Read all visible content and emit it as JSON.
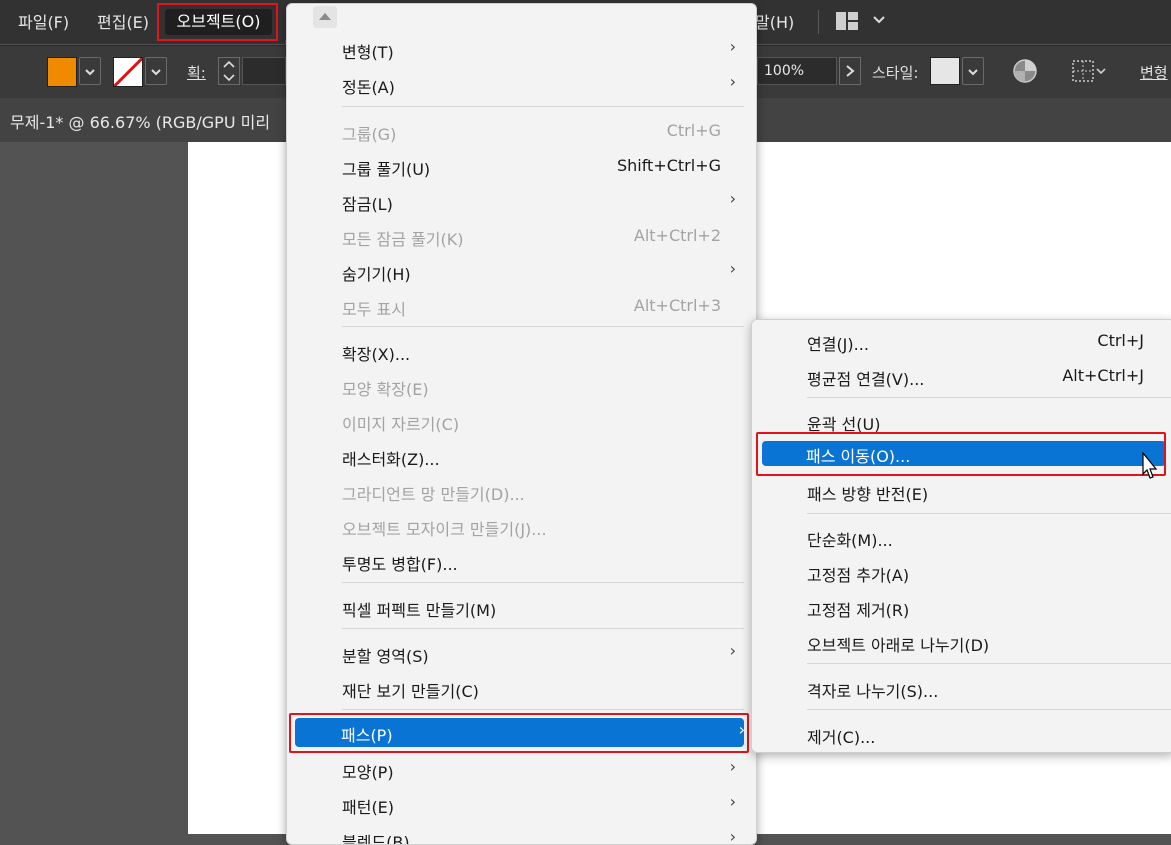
{
  "menubar": {
    "items": [
      "파일(F)",
      "편집(E)",
      "오브젝트(O)"
    ],
    "trailing_item": "말(H)"
  },
  "controlbar": {
    "fill_color": "#f08a00",
    "stroke_label": "획:",
    "opacity_value": "100%",
    "style_label": "스타일:",
    "transform_label": "변형"
  },
  "document": {
    "tab_title": "무제-1* @ 66.67% (RGB/GPU 미리"
  },
  "object_menu": {
    "items": [
      {
        "label": "변형(T)",
        "shortcut": "",
        "submenu": true,
        "disabled": false
      },
      {
        "label": "정돈(A)",
        "shortcut": "",
        "submenu": true,
        "disabled": false
      },
      {
        "label": "그룹(G)",
        "shortcut": "Ctrl+G",
        "submenu": false,
        "disabled": true
      },
      {
        "label": "그룹 풀기(U)",
        "shortcut": "Shift+Ctrl+G",
        "submenu": false,
        "disabled": false
      },
      {
        "label": "잠금(L)",
        "shortcut": "",
        "submenu": true,
        "disabled": false
      },
      {
        "label": "모든 잠금 풀기(K)",
        "shortcut": "Alt+Ctrl+2",
        "submenu": false,
        "disabled": true
      },
      {
        "label": "숨기기(H)",
        "shortcut": "",
        "submenu": true,
        "disabled": false
      },
      {
        "label": "모두 표시",
        "shortcut": "Alt+Ctrl+3",
        "submenu": false,
        "disabled": true
      },
      {
        "label": "확장(X)...",
        "shortcut": "",
        "submenu": false,
        "disabled": false
      },
      {
        "label": "모양 확장(E)",
        "shortcut": "",
        "submenu": false,
        "disabled": true
      },
      {
        "label": "이미지 자르기(C)",
        "shortcut": "",
        "submenu": false,
        "disabled": true
      },
      {
        "label": "래스터화(Z)...",
        "shortcut": "",
        "submenu": false,
        "disabled": false
      },
      {
        "label": "그라디언트 망 만들기(D)...",
        "shortcut": "",
        "submenu": false,
        "disabled": true
      },
      {
        "label": "오브젝트 모자이크 만들기(J)...",
        "shortcut": "",
        "submenu": false,
        "disabled": true
      },
      {
        "label": "투명도 병합(F)...",
        "shortcut": "",
        "submenu": false,
        "disabled": false
      },
      {
        "label": "픽셀 퍼펙트 만들기(M)",
        "shortcut": "",
        "submenu": false,
        "disabled": false
      },
      {
        "label": "분할 영역(S)",
        "shortcut": "",
        "submenu": true,
        "disabled": false
      },
      {
        "label": "재단 보기 만들기(C)",
        "shortcut": "",
        "submenu": false,
        "disabled": false
      },
      {
        "label": "패스(P)",
        "shortcut": "",
        "submenu": true,
        "disabled": false,
        "highlighted": true
      },
      {
        "label": "모양(P)",
        "shortcut": "",
        "submenu": true,
        "disabled": false
      },
      {
        "label": "패턴(E)",
        "shortcut": "",
        "submenu": true,
        "disabled": false
      },
      {
        "label": "블렌드(B)",
        "shortcut": "",
        "submenu": true,
        "disabled": false
      }
    ]
  },
  "path_submenu": {
    "items": [
      {
        "label": "연결(J)...",
        "shortcut": "Ctrl+J"
      },
      {
        "label": "평균점 연결(V)...",
        "shortcut": "Alt+Ctrl+J"
      },
      {
        "label": "윤곽 선(U)",
        "shortcut": ""
      },
      {
        "label": "패스 이동(O)...",
        "shortcut": "",
        "highlighted": true
      },
      {
        "label": "패스 방향 반전(E)",
        "shortcut": ""
      },
      {
        "label": "단순화(M)...",
        "shortcut": ""
      },
      {
        "label": "고정점 추가(A)",
        "shortcut": ""
      },
      {
        "label": "고정점 제거(R)",
        "shortcut": ""
      },
      {
        "label": "오브젝트 아래로 나누기(D)",
        "shortcut": ""
      },
      {
        "label": "격자로 나누기(S)...",
        "shortcut": ""
      },
      {
        "label": "제거(C)...",
        "shortcut": ""
      }
    ]
  },
  "colors": {
    "highlight": "#0a74d5",
    "annotation_red": "#e0141a"
  }
}
